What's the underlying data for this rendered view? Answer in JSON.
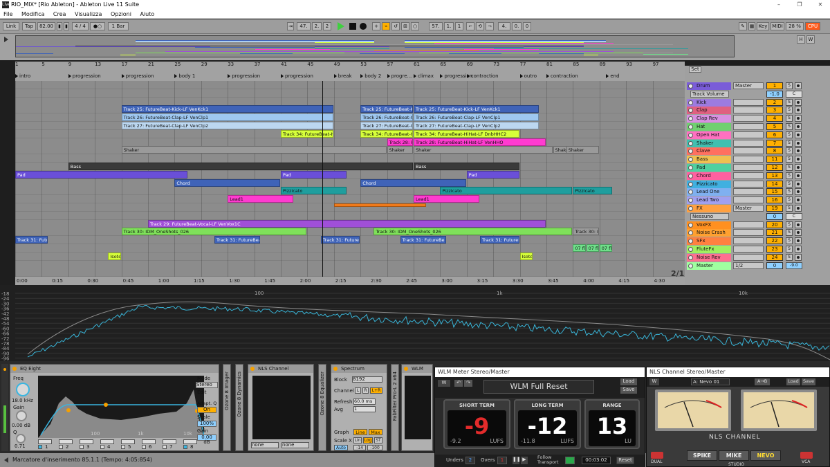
{
  "window": {
    "title": "RIO_MIX* [Rio Ableton] - Ableton Live 11 Suite",
    "app_icon": "Live",
    "minimize": "–",
    "maximize": "❐",
    "close": "✕"
  },
  "menu": [
    "File",
    "Modifica",
    "Crea",
    "Visualizza",
    "Opzioni",
    "Aiuto"
  ],
  "control_bar": {
    "link": "Link",
    "tap": "Tap",
    "tempo": "82.00",
    "meter": "4 / 4",
    "metro": "●○",
    "quantize": "1 Bar",
    "position": [
      "47.",
      "2.",
      "2"
    ],
    "loop_start": [
      "57.",
      "1.",
      "1"
    ],
    "loop_len": [
      "4.",
      "0.",
      "0"
    ],
    "key": "Key",
    "midi": "MIDI",
    "cpu_pct": "28 %",
    "cpu": "CPU"
  },
  "overview_buttons": [
    "H",
    "W"
  ],
  "bar_ruler": [
    "1",
    "5",
    "9",
    "13",
    "17",
    "21",
    "25",
    "29",
    "33",
    "37",
    "41",
    "45",
    "49",
    "53",
    "57",
    "61",
    "65",
    "69",
    "73",
    "77",
    "81",
    "85",
    "89",
    "93",
    "97"
  ],
  "locators": [
    {
      "name": "intro",
      "bar": 1
    },
    {
      "name": "progression",
      "bar": 9
    },
    {
      "name": "progression",
      "bar": 17
    },
    {
      "name": "body 1",
      "bar": 25
    },
    {
      "name": "progression",
      "bar": 33
    },
    {
      "name": "progression",
      "bar": 41
    },
    {
      "name": "break",
      "bar": 49
    },
    {
      "name": "body 2",
      "bar": 53
    },
    {
      "name": "progre...",
      "bar": 57
    },
    {
      "name": "climax",
      "bar": 61
    },
    {
      "name": "progression",
      "bar": 65
    },
    {
      "name": "contraction",
      "bar": 69
    },
    {
      "name": "outro",
      "bar": 77
    },
    {
      "name": "contraction",
      "bar": 81
    },
    {
      "name": "end",
      "bar": 90
    }
  ],
  "clips": [
    {
      "lane": 3,
      "start": 17,
      "end": 49,
      "name": "Track 25: FutureBeat-Kick-LF VenKck1",
      "color": "#3f63b8",
      "dark": true
    },
    {
      "lane": 3,
      "start": 53,
      "end": 61,
      "name": "Track 25: FutureBeat-Kick-LF",
      "color": "#3f63b8",
      "dark": true
    },
    {
      "lane": 3,
      "start": 61,
      "end": 80,
      "name": "Track 25: FutureBeat-Kick-LF VenKck1",
      "color": "#3f63b8",
      "dark": true
    },
    {
      "lane": 4,
      "start": 17,
      "end": 49,
      "name": "Track 26: FutureBeat-Clap-LF VenClp1",
      "color": "#9ec7f0"
    },
    {
      "lane": 4,
      "start": 53,
      "end": 61,
      "name": "Track 26: FutureBeat-Clap",
      "color": "#9ec7f0"
    },
    {
      "lane": 4,
      "start": 61,
      "end": 80,
      "name": "Track 26: FutureBeat-Clap-LF VenClp1",
      "color": "#9ec7f0"
    },
    {
      "lane": 5,
      "start": 17,
      "end": 49,
      "name": "Track 27: FutureBeat-Clap-LF VenClp2",
      "color": "#bcd7f0"
    },
    {
      "lane": 5,
      "start": 53,
      "end": 61,
      "name": "Track 27: FutureBeat-Cla",
      "color": "#bcd7f0"
    },
    {
      "lane": 5,
      "start": 61,
      "end": 80,
      "name": "Track 27: FutureBeat-Clap-LF VenClp2",
      "color": "#bcd7f0"
    },
    {
      "lane": 6,
      "start": 41,
      "end": 49,
      "name": "Track 34: FutureBeat-HiHa",
      "color": "#d6ff3a"
    },
    {
      "lane": 6,
      "start": 53,
      "end": 61,
      "name": "Track 34: FutureBeat-HiH",
      "color": "#d6ff3a"
    },
    {
      "lane": 6,
      "start": 61,
      "end": 77,
      "name": "Track 34: FutureBeat-HiHat-LF DnbHHC2",
      "color": "#d6ff3a"
    },
    {
      "lane": 7,
      "start": 57,
      "end": 61,
      "name": "Track 28: Fu",
      "color": "#ff3bd0"
    },
    {
      "lane": 7,
      "start": 61,
      "end": 81,
      "name": "Track 28: FutureBeat-HiHat-LF VenHHO",
      "color": "#ff3bd0"
    },
    {
      "lane": 8,
      "start": 17,
      "end": 57,
      "name": "Shaker",
      "color": "#9a9a9a"
    },
    {
      "lane": 8,
      "start": 57,
      "end": 61,
      "name": "Shaker",
      "color": "#9a9a9a"
    },
    {
      "lane": 8,
      "start": 61,
      "end": 82,
      "name": "Shaker",
      "color": "#9a9a9a"
    },
    {
      "lane": 8,
      "start": 82,
      "end": 85,
      "name": "Shake",
      "color": "#9a9a9a"
    },
    {
      "lane": 8,
      "start": 84,
      "end": 89,
      "name": "Shaker",
      "color": "#9a9a9a"
    },
    {
      "lane": 10,
      "start": 9,
      "end": 61,
      "name": "Bass",
      "color": "#3a3a3a",
      "dark": true
    },
    {
      "lane": 10,
      "start": 61,
      "end": 77,
      "name": "Bass",
      "color": "#3a3a3a",
      "dark": true
    },
    {
      "lane": 11,
      "start": 1,
      "end": 27,
      "name": "Pad",
      "color": "#6a4fd8",
      "dark": true
    },
    {
      "lane": 11,
      "start": 41,
      "end": 51,
      "name": "Pad",
      "color": "#6a4fd8",
      "dark": true
    },
    {
      "lane": 11,
      "start": 69,
      "end": 77,
      "name": "Pad",
      "color": "#6a4fd8",
      "dark": true
    },
    {
      "lane": 12,
      "start": 25,
      "end": 41,
      "name": "Chord",
      "color": "#3f63b8",
      "dark": true
    },
    {
      "lane": 12,
      "start": 53,
      "end": 69,
      "name": "Chord",
      "color": "#3f63b8",
      "dark": true
    },
    {
      "lane": 13,
      "start": 41,
      "end": 51,
      "name": "Pizzicato",
      "color": "#1f9e9e"
    },
    {
      "lane": 13,
      "start": 65,
      "end": 85,
      "name": "Pizzicato",
      "color": "#1f9e9e"
    },
    {
      "lane": 13,
      "start": 85,
      "end": 91,
      "name": "Pizzicato",
      "color": "#1f9e9e"
    },
    {
      "lane": 14,
      "start": 33,
      "end": 43,
      "name": "Lead1",
      "color": "#ff3bd0"
    },
    {
      "lane": 14,
      "start": 61,
      "end": 71,
      "name": "Lead1",
      "color": "#ff3bd0"
    },
    {
      "lane": 15,
      "start": 49,
      "end": 63,
      "name": "",
      "color": "#f07a1a"
    },
    {
      "lane": 17,
      "start": 21,
      "end": 81,
      "name": "Track 29: FutureBeat-Vocal-LF VenVox1C",
      "color": "#a04fd8",
      "dark": true
    },
    {
      "lane": 18,
      "start": 17,
      "end": 45,
      "name": "Track 30: IDM_OneShots_026",
      "color": "#7fe05a"
    },
    {
      "lane": 18,
      "start": 55,
      "end": 85,
      "name": "Track 30: IDM_OneShots_026",
      "color": "#7fe05a"
    },
    {
      "lane": 18,
      "start": 85,
      "end": 89,
      "name": "Track 30: IDI",
      "color": "#9a9a9a"
    },
    {
      "lane": 19,
      "start": 1,
      "end": 6,
      "name": "Track 31: Future",
      "color": "#3f63b8",
      "dark": true
    },
    {
      "lane": 19,
      "start": 31,
      "end": 38,
      "name": "Track 31: FutureBeat-",
      "color": "#3f63b8",
      "dark": true
    },
    {
      "lane": 19,
      "start": 47,
      "end": 53,
      "name": "Track 31: FutureBe",
      "color": "#3f63b8",
      "dark": true
    },
    {
      "lane": 19,
      "start": 59,
      "end": 66,
      "name": "Track 31: FutureBe",
      "color": "#3f63b8",
      "dark": true
    },
    {
      "lane": 19,
      "start": 71,
      "end": 77,
      "name": "Track 31: FutureBe",
      "color": "#3f63b8",
      "dark": true
    },
    {
      "lane": 20,
      "start": 85,
      "end": 87,
      "name": "07 fl",
      "color": "#6fe08a"
    },
    {
      "lane": 20,
      "start": 87,
      "end": 89,
      "name": "07 fl",
      "color": "#6fe08a"
    },
    {
      "lane": 20,
      "start": 89,
      "end": 91,
      "name": "07 flu",
      "color": "#6fe08a"
    },
    {
      "lane": 21,
      "start": 15,
      "end": 17,
      "name": "Isoto",
      "color": "#d6ff3a"
    },
    {
      "lane": 21,
      "start": 77,
      "end": 79,
      "name": "Isoton",
      "color": "#d6ff3a"
    }
  ],
  "time_ruler": [
    "0:00",
    "0:15",
    "0:30",
    "0:45",
    "1:00",
    "1:15",
    "1:30",
    "1:45",
    "2:00",
    "2:15",
    "2:30",
    "2:45",
    "3:00",
    "3:15",
    "3:30",
    "3:45",
    "4:00",
    "4:15",
    "4:30"
  ],
  "page_indicator": "2/1",
  "set_label": "Set",
  "mixer": [
    {
      "name": "Drum",
      "color": "#7a5cd8",
      "route": "Master",
      "num": "1",
      "s": "S",
      "group": true
    },
    {
      "name": "",
      "color": "",
      "route": "Track Volume",
      "num": "-1.0",
      "s": "C",
      "sub": true
    },
    {
      "name": "Kick",
      "color": "#9c7be0",
      "num": "2",
      "s": "S"
    },
    {
      "name": "Clap",
      "color": "#e06080",
      "num": "3",
      "s": "S"
    },
    {
      "name": "Clap Rev",
      "color": "#d890e0",
      "num": "4",
      "s": "S"
    },
    {
      "name": "Hat",
      "color": "#70d070",
      "num": "5",
      "s": "S"
    },
    {
      "name": "Open Hat",
      "color": "#ff70c0",
      "num": "6",
      "s": "S"
    },
    {
      "name": "Shaker",
      "color": "#40c0b0",
      "num": "7",
      "s": "S"
    },
    {
      "name": "Clave",
      "color": "#ff7060",
      "num": "8",
      "s": "S"
    },
    {
      "name": "Bass",
      "color": "#f0c050",
      "num": "11",
      "s": "S"
    },
    {
      "name": "Pad",
      "color": "#50d0a0",
      "num": "12",
      "s": "S"
    },
    {
      "name": "Chord",
      "color": "#ff60a0",
      "num": "13",
      "s": "S"
    },
    {
      "name": "Pizzicato",
      "color": "#40b0e0",
      "num": "14",
      "s": "S"
    },
    {
      "name": "Lead One",
      "color": "#7fb0f0",
      "num": "15",
      "s": "S"
    },
    {
      "name": "Lead Two",
      "color": "#a0a0f0",
      "num": "16",
      "s": "S"
    },
    {
      "name": "FX",
      "color": "#ffa040",
      "route": "Master",
      "num": "19",
      "s": "S",
      "group": true
    },
    {
      "name": "",
      "color": "",
      "route": "Nessuno",
      "num": "0",
      "s": "C",
      "sub": true
    },
    {
      "name": "VoxFX",
      "color": "#ff9020",
      "num": "20",
      "s": "S"
    },
    {
      "name": "Noise Crash",
      "color": "#ffa030",
      "num": "21",
      "s": "S"
    },
    {
      "name": "SFx",
      "color": "#ff8040",
      "num": "22",
      "s": "S"
    },
    {
      "name": "FluteFx",
      "color": "#a0f060",
      "num": "23",
      "s": "S"
    },
    {
      "name": "Noise Rev",
      "color": "#ff7090",
      "num": "24",
      "s": "S"
    },
    {
      "name": "Master",
      "color": "#a0ffa0",
      "route": "1/2",
      "num": "0",
      "s": "-9.0",
      "master": true
    }
  ],
  "spectrum": {
    "db_labels": [
      "-18",
      "-24",
      "-30",
      "-36",
      "-42",
      "-48",
      "-54",
      "-60",
      "-66",
      "-72",
      "-78",
      "-84",
      "-90",
      "-96"
    ],
    "freq_labels": [
      "100",
      "1k",
      "10k"
    ]
  },
  "devices": {
    "eq8": {
      "title": "EQ Eight",
      "freq_label": "Freq",
      "freq": "18.0 kHz",
      "gain_label": "Gain",
      "gain": "0.00 dB",
      "q": "0.71",
      "q_label": "Q",
      "mode_label": "Mode",
      "mode": "Stereo",
      "edit": "Edit",
      "adapt_label": "Adapt. Q",
      "adapt": "On",
      "scale_label": "Scale",
      "scale": "100%",
      "outgain_label": "Gain",
      "outgain": "0.00 dB",
      "bands": [
        "1",
        "2",
        "3",
        "4",
        "5",
        "6",
        "7",
        "8"
      ],
      "freq_ticks": [
        "100",
        "1k",
        "10k"
      ]
    },
    "ozone_imager": "Ozone 8 Imager",
    "ozone_dyn": "Ozone 8 Dynamics",
    "nls": {
      "title": "NLS Channel",
      "sel1": "none",
      "sel2": "none"
    },
    "ozone_eq": "Ozone 8 Equalizer",
    "spectrum": {
      "title": "Spectrum",
      "block_label": "Block",
      "block": "8192",
      "channel_label": "Channel",
      "ch": [
        "L",
        "R",
        "L+R"
      ],
      "refresh_label": "Refresh",
      "refresh": "60.0 ms",
      "avg_label": "Avg",
      "avg": "1",
      "graph_label": "Graph",
      "graph": [
        "Line",
        "Max"
      ],
      "scalex_label": "Scale X",
      "scalex": [
        "Lin",
        "Log",
        "ST"
      ],
      "auto": "Auto",
      "range": [
        "-14",
        "-100"
      ]
    },
    "fabfilter": "FabFilter Pro-L 2 x64",
    "wlm_tab": "WLM"
  },
  "status": {
    "text": "Marcatore d'inserimento 85.1.1 (Tempo: 4:05:854)"
  },
  "wlm": {
    "window_title": "WLM Meter Stereo/Master",
    "preset": "WLM Full Reset",
    "load": "Load",
    "save": "Save",
    "short": {
      "label": "SHORT TERM",
      "value": "-9",
      "peak": "-9.2",
      "unit": "LUFS"
    },
    "long": {
      "label": "LONG TERM",
      "value": "-12",
      "peak": "-11.8",
      "unit": "LUFS"
    },
    "range": {
      "label": "RANGE",
      "value": "13",
      "unit": "LU"
    },
    "unders_label": "Unders",
    "unders": "2",
    "overs_label": "Overs",
    "overs": "1",
    "follow": "Follow Transport",
    "time": "00:03:02",
    "reset": "Reset"
  },
  "nls_win": {
    "window_title": "NLS Channel Stereo/Master",
    "preset": "A: Nevo 01",
    "ab": "A→B",
    "load": "Load",
    "save": "Save",
    "brand": "NLS CHANNEL",
    "models": [
      "SPIKE",
      "MIKE",
      "NEVO"
    ],
    "dual": "DUAL",
    "vca": "VCA",
    "studio": "STUDIO"
  },
  "colors": {
    "accent": "#ffb000",
    "play": "#3fd03f",
    "wlm_red": "#e32b2b"
  }
}
